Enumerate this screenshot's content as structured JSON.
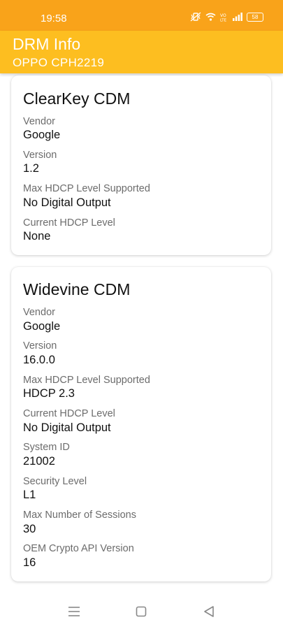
{
  "status_bar": {
    "time": "19:58",
    "battery": "58",
    "icons": [
      "vibrate-icon",
      "wifi-icon",
      "volte-icon",
      "signal-icon",
      "battery-icon"
    ]
  },
  "app_bar": {
    "title": "DRM Info",
    "subtitle": "OPPO CPH2219",
    "color": "#fdbe20"
  },
  "cards": [
    {
      "title": "ClearKey CDM",
      "fields": [
        {
          "label": "Vendor",
          "value": "Google"
        },
        {
          "label": "Version",
          "value": "1.2"
        },
        {
          "label": "Max HDCP Level Supported",
          "value": "No Digital Output"
        },
        {
          "label": "Current HDCP Level",
          "value": "None"
        }
      ]
    },
    {
      "title": "Widevine CDM",
      "fields": [
        {
          "label": "Vendor",
          "value": "Google"
        },
        {
          "label": "Version",
          "value": "16.0.0"
        },
        {
          "label": "Max HDCP Level Supported",
          "value": "HDCP 2.3"
        },
        {
          "label": "Current HDCP Level",
          "value": "No Digital Output"
        },
        {
          "label": "System ID",
          "value": "21002"
        },
        {
          "label": "Security Level",
          "value": "L1"
        },
        {
          "label": "Max Number of Sessions",
          "value": "30"
        },
        {
          "label": "OEM Crypto API Version",
          "value": "16"
        }
      ]
    }
  ],
  "nav_bar": {
    "icons": [
      "menu-icon",
      "home-icon",
      "back-icon"
    ]
  }
}
